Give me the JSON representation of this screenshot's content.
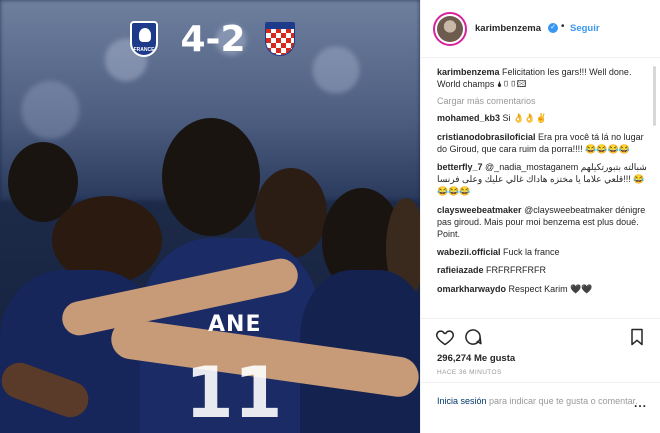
{
  "post": {
    "score": "4-2",
    "crest_text": "FRANCE",
    "jersey_name": "ANE",
    "jersey_number": "11"
  },
  "header": {
    "username": "karimbenzema",
    "verified_icon": "check",
    "separator": "•",
    "follow_label": "Seguir"
  },
  "comments": {
    "caption_user": "karimbenzema",
    "caption_text": "Felicitation les gars!!! Well done. World champs 🌢▯▯🖾",
    "load_more": "Cargar más comentarios",
    "items": [
      {
        "user": "mohamed_kb3",
        "text": "Si 👌👌✌"
      },
      {
        "user": "cristianodobrasiloficial",
        "text": "Era pra você tá lá no lugar do Giroud, que cara ruim da porra!!!! 😂😂😂😂"
      },
      {
        "user": "betterfly_7",
        "text": "@_nadia_mostaganem شبالته بتبورتكيلهم قلعي علاما يا مختزه هاداك غالي عليك وعلى فرنسا!!! 😂😂😂😂"
      },
      {
        "user": "claysweebeatmaker",
        "text": "@claysweebeatmaker dénigre pas giroud. Mais pour moi benzema est plus doué. Point."
      },
      {
        "user": "wabezii.official",
        "text": "Fuck la france"
      },
      {
        "user": "rafieiazade",
        "text": "FRFRFRFRFR"
      },
      {
        "user": "omarkharwaydo",
        "text": "Respect Karim 🖤🖤"
      }
    ]
  },
  "actions": {
    "like_icon": "heart-outline",
    "comment_icon": "speech-bubble",
    "bookmark_icon": "bookmark",
    "likes": "296,274 Me gusta",
    "time": "HACE 36 MINUTOS"
  },
  "login": {
    "link": "Inicia sesión",
    "text": " para indicar que te gusta o comentar.",
    "more": "..."
  },
  "colors": {
    "accent": "#3897f0",
    "muted": "#999999",
    "france_blue": "#1e3a8a",
    "croatia_red": "#d52b1e"
  }
}
